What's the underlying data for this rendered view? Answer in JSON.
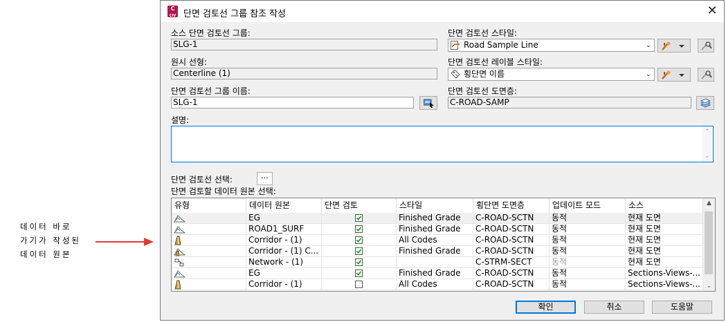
{
  "annotation": {
    "line1": "데이터 바로",
    "line2": "가기가 작성된",
    "line3": "데이터 원본"
  },
  "dialog": {
    "title": "단면 검토선 그룹 참조 작성",
    "app_icon_text": "C",
    "app_icon_subtext": "CIV",
    "close_glyph": "✕"
  },
  "fields": {
    "source_group_label": "소스 단면 검토선 그룹:",
    "source_group_value": "SLG-1",
    "alignment_label": "원시 선형:",
    "alignment_value": "Centerline (1)",
    "group_name_label": "단면 검토선 그룹 이름:",
    "group_name_value": "SLG-1",
    "sample_line_style_label": "단면 검토선 스타일:",
    "sample_line_style_value": "Road Sample Line",
    "label_style_label": "단면 검토선 레이블 스타일:",
    "label_style_value": "횡단면 이름",
    "layer_label": "단면 검토선 도면층:",
    "layer_value": "C-ROAD-SAMP",
    "description_label": "설명:",
    "description_value": "",
    "select_sample_lines_label": "단면 검토선 선택:",
    "select_sources_label": "단면 검토할 데이터 원본 선택:",
    "dots_glyph": "···"
  },
  "grid": {
    "columns": [
      "유형",
      "데이터 원본",
      "단면 검토",
      "스타일",
      "횡단면 도면층",
      "업데이트 모드",
      "소스"
    ],
    "rows": [
      {
        "type_icon": "surface-icon",
        "source": "EG",
        "checked": true,
        "style": "Finished Grade",
        "layer": "C-ROAD-SCTN",
        "mode": "동적",
        "mode_gray": false,
        "origin": "현재 도면",
        "selected": true
      },
      {
        "type_icon": "surface-icon",
        "source": "ROAD1_SURF",
        "checked": true,
        "style": "Finished Grade",
        "layer": "C-ROAD-SCTN",
        "mode": "동적",
        "mode_gray": false,
        "origin": "현재 도면",
        "selected": false
      },
      {
        "type_icon": "corridor-icon",
        "source": "Corridor - (1)",
        "checked": true,
        "style": "All Codes",
        "layer": "C-ROAD-SCTN",
        "mode": "동적",
        "mode_gray": false,
        "origin": "현재 도면",
        "selected": false
      },
      {
        "type_icon": "corridor-surface-icon",
        "source": "Corridor - (1) C...",
        "checked": true,
        "style": "Finished Grade",
        "layer": "C-ROAD-SCTN",
        "mode": "동적",
        "mode_gray": false,
        "origin": "현재 도면",
        "selected": false
      },
      {
        "type_icon": "pipe-network-icon",
        "source": "Network - (1)",
        "checked": true,
        "style": "",
        "layer": "C-STRM-SECT",
        "mode": "동적",
        "mode_gray": true,
        "origin": "현재 도면",
        "selected": false
      },
      {
        "type_icon": "surface-icon",
        "source": "EG",
        "checked": true,
        "style": "Finished Grade",
        "layer": "C-ROAD-SCTN",
        "mode": "동적",
        "mode_gray": false,
        "origin": "Sections-Views-...",
        "selected": false
      },
      {
        "type_icon": "corridor-icon",
        "source": "Corridor - (1)",
        "checked": false,
        "style": "All Codes",
        "layer": "C-ROAD-SCTN",
        "mode": "동적",
        "mode_gray": false,
        "origin": "Sections-Views-...",
        "selected": false
      }
    ]
  },
  "buttons": {
    "ok": "확인",
    "cancel": "취소",
    "help": "도움말"
  },
  "colors": {
    "accent": "#0078d7",
    "arrow": "#e53935",
    "app_icon": "#b5164d"
  }
}
